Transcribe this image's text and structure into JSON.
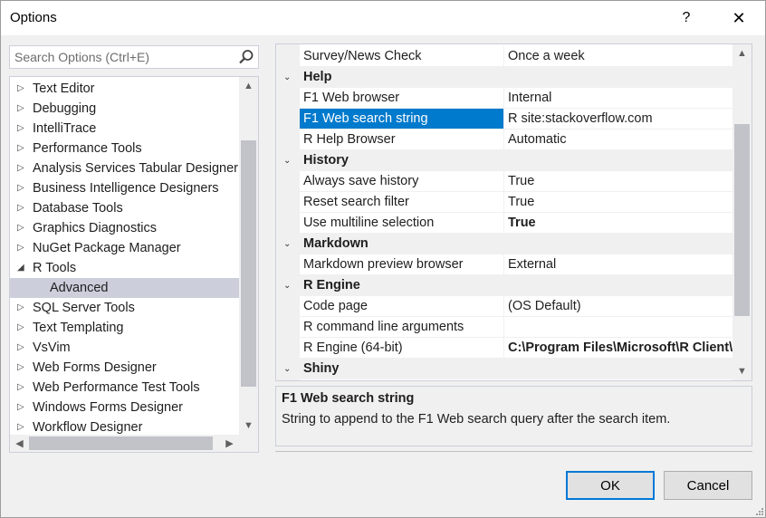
{
  "window": {
    "title": "Options",
    "help": "?",
    "close": "✕"
  },
  "search": {
    "placeholder": "Search Options (Ctrl+E)"
  },
  "tree": {
    "items": [
      {
        "label": "Text Editor",
        "arrow": "▷"
      },
      {
        "label": "Debugging",
        "arrow": "▷"
      },
      {
        "label": "IntelliTrace",
        "arrow": "▷"
      },
      {
        "label": "Performance Tools",
        "arrow": "▷"
      },
      {
        "label": "Analysis Services Tabular Designer",
        "arrow": "▷"
      },
      {
        "label": "Business Intelligence Designers",
        "arrow": "▷"
      },
      {
        "label": "Database Tools",
        "arrow": "▷"
      },
      {
        "label": "Graphics Diagnostics",
        "arrow": "▷"
      },
      {
        "label": "NuGet Package Manager",
        "arrow": "▷"
      },
      {
        "label": "R Tools",
        "arrow": "◢"
      },
      {
        "label": "Advanced",
        "arrow": ""
      },
      {
        "label": "SQL Server Tools",
        "arrow": "▷"
      },
      {
        "label": "Text Templating",
        "arrow": "▷"
      },
      {
        "label": "VsVim",
        "arrow": "▷"
      },
      {
        "label": "Web Forms Designer",
        "arrow": "▷"
      },
      {
        "label": "Web Performance Test Tools",
        "arrow": "▷"
      },
      {
        "label": "Windows Forms Designer",
        "arrow": "▷"
      },
      {
        "label": "Workflow Designer",
        "arrow": "▷"
      }
    ],
    "selected": "Advanced"
  },
  "grid": {
    "rows": [
      {
        "type": "prop",
        "name": "Survey/News Check",
        "value": "Once a week"
      },
      {
        "type": "cat",
        "name": "Help",
        "glyph": "⌄"
      },
      {
        "type": "prop",
        "name": "F1 Web browser",
        "value": "Internal"
      },
      {
        "type": "prop",
        "name": "F1 Web search string",
        "value": "R site:stackoverflow.com",
        "selected": true
      },
      {
        "type": "prop",
        "name": "R Help Browser",
        "value": "Automatic"
      },
      {
        "type": "cat",
        "name": "History",
        "glyph": "⌄"
      },
      {
        "type": "prop",
        "name": "Always save history",
        "value": "True"
      },
      {
        "type": "prop",
        "name": "Reset search filter",
        "value": "True"
      },
      {
        "type": "prop",
        "name": "Use multiline selection",
        "value": "True",
        "bold": true
      },
      {
        "type": "cat",
        "name": "Markdown",
        "glyph": "⌄"
      },
      {
        "type": "prop",
        "name": "Markdown preview browser",
        "value": "External"
      },
      {
        "type": "cat",
        "name": "R Engine",
        "glyph": "⌄"
      },
      {
        "type": "prop",
        "name": "Code page",
        "value": "(OS Default)"
      },
      {
        "type": "prop",
        "name": "R command line arguments",
        "value": ""
      },
      {
        "type": "prop",
        "name": "R Engine (64-bit)",
        "value": "C:\\Program Files\\Microsoft\\R Client\\R_SERVER",
        "bold": true
      },
      {
        "type": "cat",
        "name": "Shiny",
        "glyph": "⌄"
      }
    ]
  },
  "description": {
    "title": "F1 Web search string",
    "text": "String to append to the F1 Web search query after the search item."
  },
  "buttons": {
    "ok": "OK",
    "cancel": "Cancel"
  },
  "colors": {
    "selection": "#007acc",
    "tree_selection": "#cccedb",
    "default_button_border": "#0078d7"
  }
}
